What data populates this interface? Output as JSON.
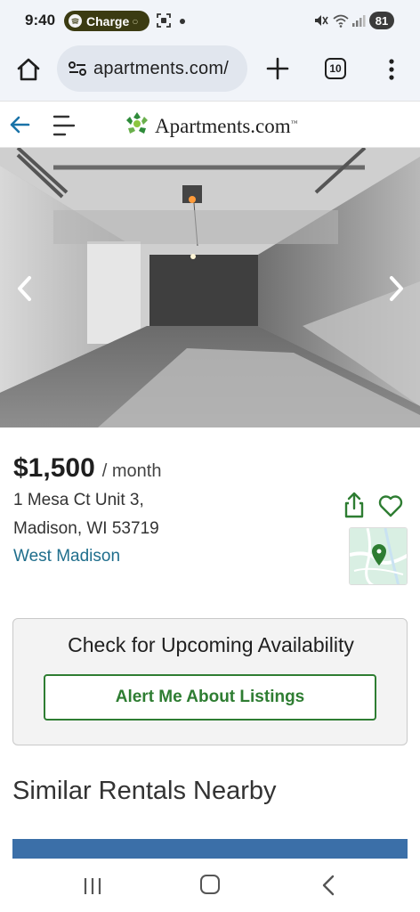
{
  "status_bar": {
    "time": "9:40",
    "charge_label": "Charge",
    "battery": "81"
  },
  "browser": {
    "url": "apartments.com/",
    "tab_count": "10"
  },
  "site": {
    "logo_text": "Apartments.com",
    "logo_tm": "™"
  },
  "listing": {
    "price": "$1,500",
    "per": "/ month",
    "address_line1": "1 Mesa Ct Unit 3,",
    "address_line2": "Madison, WI 53719",
    "neighborhood": "West Madison"
  },
  "availability": {
    "title": "Check for Upcoming Availability",
    "button_label": "Alert Me About Listings"
  },
  "similar": {
    "title": "Similar Rentals Nearby"
  },
  "colors": {
    "brand_green": "#2e7d32",
    "link_blue": "#1f6e8c",
    "back_arrow": "#1a73a8"
  }
}
